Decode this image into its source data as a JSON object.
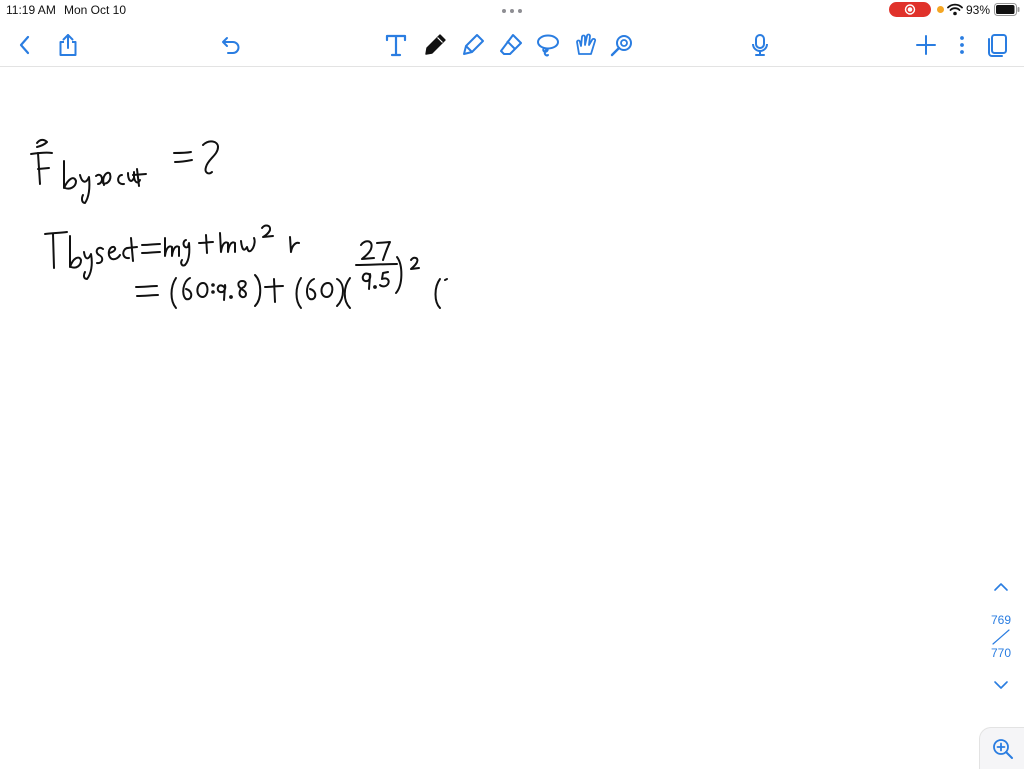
{
  "status_bar": {
    "time": "11:19 AM",
    "date": "Mon Oct 10",
    "battery_percent": "93%",
    "battery_level": 0.93,
    "recording_active": true,
    "colors": {
      "recording": "#e0322a",
      "mic_indicator": "#f5a623"
    }
  },
  "toolbar": {
    "accent_color": "#2a7de1",
    "left_tools": [
      "back-chevron-icon",
      "share-icon",
      "undo-icon"
    ],
    "tools": [
      "text-tool-icon",
      "pen-icon",
      "highlighter-icon",
      "eraser-icon",
      "lasso-icon",
      "shapes-icon",
      "laser-pointer-icon"
    ],
    "selected_tool": "pen-icon",
    "right_tools": [
      "microphone-icon",
      "add-icon",
      "more-icon",
      "pages-icon"
    ]
  },
  "canvas": {
    "handwriting": [
      "F⃗ by seat = ?",
      "F by seat = mg + mω²r",
      "= (60·9.8) + (60)(2π/9.5)² ("
    ]
  },
  "pager": {
    "current_page": "769",
    "total_pages": "770"
  }
}
